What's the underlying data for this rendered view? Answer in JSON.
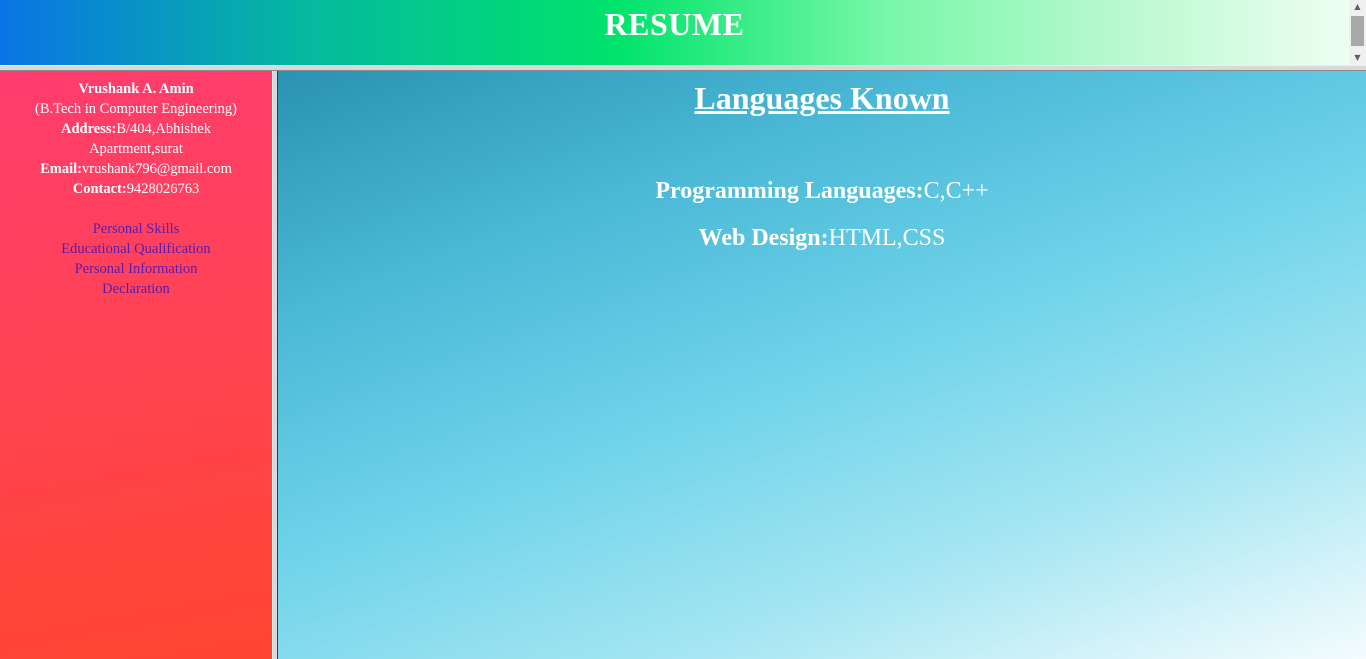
{
  "header": {
    "title": "RESUME"
  },
  "sidebar": {
    "name": "Vrushank A. Amin",
    "degree": "(B.Tech in Computer Engineering)",
    "address_label": "Address:",
    "address_line1": "B/404,Abhishek",
    "address_line2": "Apartment,surat",
    "email_label": "Email:",
    "email_value": "vrushank796@gmail.com",
    "contact_label": "Contact:",
    "contact_value": "9428026763",
    "nav": [
      {
        "label": "Personal Skills"
      },
      {
        "label": "Educational Qualification"
      },
      {
        "label": "Personal Information"
      },
      {
        "label": "Declaration"
      }
    ]
  },
  "main": {
    "heading": "Languages Known",
    "rows": [
      {
        "key": "Programming Languages:",
        "value": "C,C++"
      },
      {
        "key": "Web Design:",
        "value": "HTML,CSS"
      }
    ]
  },
  "colors": {
    "header_gradient_start": "#0a74e6",
    "header_gradient_mid": "#00e36b",
    "sidebar_bg": "#ff4257",
    "nav_link": "#5a1cb0",
    "main_gradient_start": "#2a92b2",
    "main_gradient_end": "#f4fcfe"
  },
  "icons": {
    "scroll_up": "arrow-up-icon",
    "scroll_down": "arrow-down-icon"
  }
}
